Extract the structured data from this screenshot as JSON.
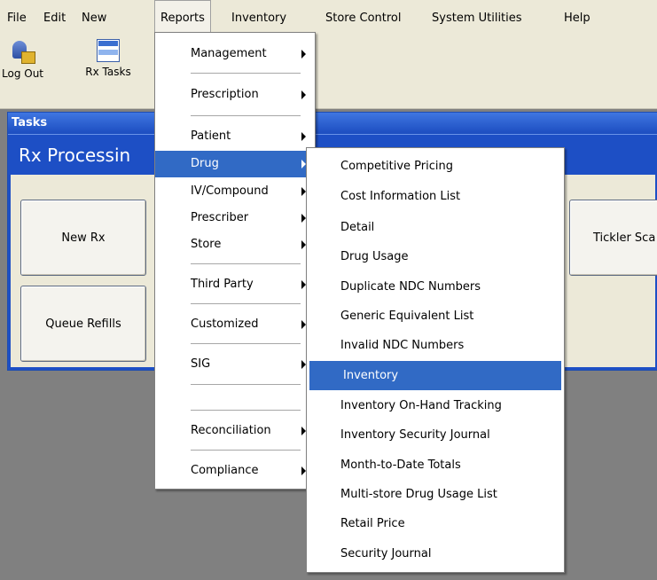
{
  "menubar": {
    "items": [
      {
        "label": "File"
      },
      {
        "label": "Edit"
      },
      {
        "label": "New"
      },
      {
        "label": "Reports"
      },
      {
        "label": "Inventory"
      },
      {
        "label": "Store Control"
      },
      {
        "label": "System Utilities"
      },
      {
        "label": "Help"
      }
    ]
  },
  "toolbar": {
    "logout_label": "Log Out",
    "logout_icon": "logout-lock-icon",
    "rxtasks_label": "Rx Tasks",
    "rxtasks_icon": "tasks-window-icon"
  },
  "tasks_panel": {
    "header": "Tasks",
    "section_title": "Rx Processin",
    "buttons": [
      {
        "label": "New Rx"
      },
      {
        "label": "Queue Refills"
      },
      {
        "label": "Tickler Sca"
      }
    ]
  },
  "reports_menu": {
    "items": [
      {
        "label": "Management",
        "has_submenu": true
      },
      {
        "label": "Prescription",
        "has_submenu": true
      },
      {
        "label": "Patient",
        "has_submenu": true
      },
      {
        "label": "Drug",
        "has_submenu": true,
        "selected": true
      },
      {
        "label": "IV/Compound",
        "has_submenu": true
      },
      {
        "label": "Prescriber",
        "has_submenu": true
      },
      {
        "label": "Store",
        "has_submenu": true
      },
      {
        "label": "Third Party",
        "has_submenu": true
      },
      {
        "label": "Customized",
        "has_submenu": true
      },
      {
        "label": "SIG",
        "has_submenu": true
      },
      {
        "label": "Reconciliation",
        "has_submenu": true
      },
      {
        "label": "Compliance",
        "has_submenu": true
      }
    ]
  },
  "drug_submenu": {
    "items": [
      {
        "label": "Competitive Pricing"
      },
      {
        "label": "Cost Information List"
      },
      {
        "label": "Detail"
      },
      {
        "label": "Drug Usage"
      },
      {
        "label": "Duplicate NDC Numbers"
      },
      {
        "label": "Generic Equivalent List"
      },
      {
        "label": "Invalid NDC Numbers"
      },
      {
        "label": "Inventory",
        "selected": true
      },
      {
        "label": "Inventory On-Hand Tracking"
      },
      {
        "label": "Inventory Security Journal"
      },
      {
        "label": "Month-to-Date Totals"
      },
      {
        "label": "Multi-store Drug Usage List"
      },
      {
        "label": "Retail Price"
      },
      {
        "label": "Security Journal"
      }
    ]
  },
  "colors": {
    "menu_highlight": "#316ac5",
    "title_blue": "#1d4fc5",
    "chrome": "#ece9d8",
    "desktop": "#808080"
  }
}
